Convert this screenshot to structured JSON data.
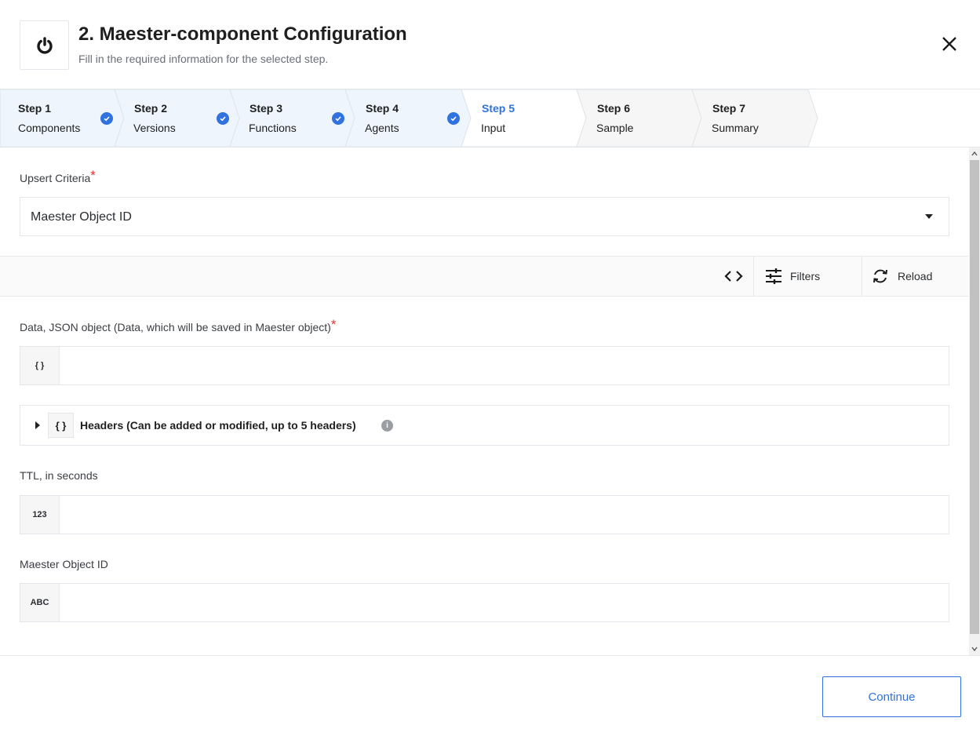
{
  "header": {
    "title": "2. Maester-component Configuration",
    "subtitle": "Fill in the required information for the selected step.",
    "logo_icon": "power-icon",
    "close_icon": "close-icon"
  },
  "stepper": {
    "steps": [
      {
        "num": "Step 1",
        "name": "Components",
        "state": "done"
      },
      {
        "num": "Step 2",
        "name": "Versions",
        "state": "done"
      },
      {
        "num": "Step 3",
        "name": "Functions",
        "state": "done"
      },
      {
        "num": "Step 4",
        "name": "Agents",
        "state": "done"
      },
      {
        "num": "Step 5",
        "name": "Input",
        "state": "active"
      },
      {
        "num": "Step 6",
        "name": "Sample",
        "state": "pending"
      },
      {
        "num": "Step 7",
        "name": "Summary",
        "state": "pending"
      }
    ]
  },
  "form": {
    "upsert_label": "Upsert Criteria",
    "required_mark": "*",
    "upsert_value": "Maester Object ID",
    "toolbar": {
      "code_icon": "code-icon",
      "filters_label": "Filters",
      "reload_label": "Reload"
    },
    "data_label": "Data, JSON object (Data, which will be saved in Maester object)",
    "data_type": "{ }",
    "data_value": "",
    "headers_label": "Headers (Can be added or modified, up to 5 headers)",
    "headers_type": "{ }",
    "info_glyph": "i",
    "ttl_label": "TTL, in seconds",
    "ttl_type": "123",
    "ttl_value": "",
    "object_id_label": "Maester Object ID",
    "object_id_type": "ABC",
    "object_id_value": ""
  },
  "footer": {
    "continue_label": "Continue"
  },
  "colors": {
    "accent": "#2f72e0",
    "required": "#e0352f",
    "completed_step_bg": "#eef5fd"
  }
}
